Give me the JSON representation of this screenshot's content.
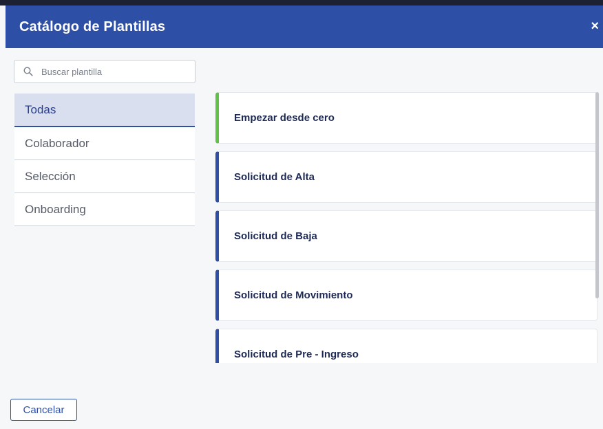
{
  "dialog": {
    "title": "Catálogo de Plantillas",
    "close_symbol": "×"
  },
  "search": {
    "placeholder": "Buscar plantilla",
    "value": "",
    "icon": "search-icon"
  },
  "sidebar": {
    "items": [
      {
        "label": "Todas",
        "active": true
      },
      {
        "label": "Colaborador",
        "active": false
      },
      {
        "label": "Selección",
        "active": false
      },
      {
        "label": "Onboarding",
        "active": false
      }
    ]
  },
  "templates": [
    {
      "label": "Empezar desde cero",
      "accent": "#64c148"
    },
    {
      "label": "Solicitud de Alta",
      "accent": "#2e4fa6"
    },
    {
      "label": "Solicitud de Baja",
      "accent": "#2e4fa6"
    },
    {
      "label": "Solicitud de Movimiento",
      "accent": "#2e4fa6"
    },
    {
      "label": "Solicitud de Pre - Ingreso",
      "accent": "#2e4fa6"
    }
  ],
  "footer": {
    "cancel_label": "Cancelar"
  },
  "colors": {
    "header": "#2e4fa6",
    "active_tab_bg": "#d9dfee"
  }
}
